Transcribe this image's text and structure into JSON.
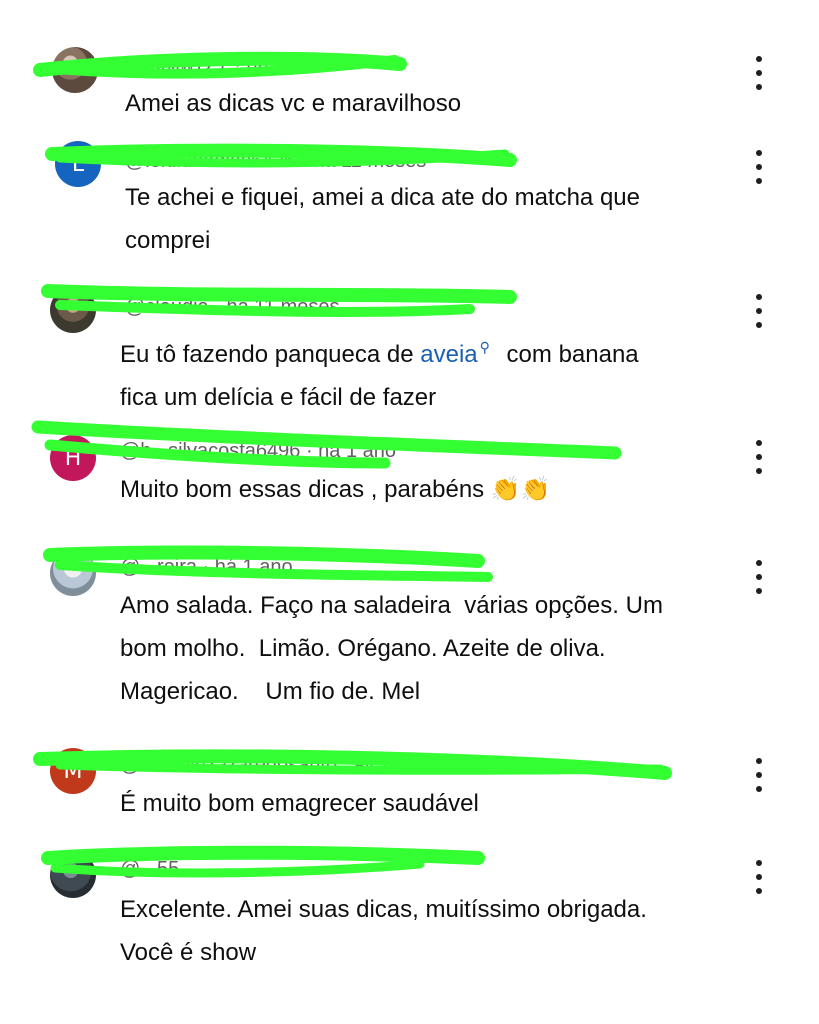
{
  "comments": [
    {
      "author": "@lucilw7Z7 · há 1 ano",
      "avatar_letter": "",
      "text": "Amei as dicas vc e maravilhoso"
    },
    {
      "author": "@leidiunedias5426 · há 11 meses",
      "avatar_letter": "L",
      "text": "Te achei e fiquei, amei a dica ate do matcha que\ncomprei"
    },
    {
      "author": "@claudia · há 11 meses",
      "avatar_letter": "",
      "text_before": "Eu tô fazendo panqueca de ",
      "link_text": "aveia",
      "link_icon": "search-icon",
      "text_after": " com banana\nfica um delícia e fácil de fazer"
    },
    {
      "author": "@h...silvacosta6496 · há 1 ano",
      "avatar_letter": "H",
      "text": "Muito bom essas dicas , parabéns ",
      "emoji": "👏👏"
    },
    {
      "author": "@...reira · há 1 ano",
      "avatar_letter": "",
      "text": "Amo salada. Faço na saladeira  várias opções. Um\nbom molho.  Limão. Orégano. Azeite de oliva.\nMagericao.    Um fio de. Mel"
    },
    {
      "author": "@marialuzazaredosanto...ail.785 · há 11 meses",
      "avatar_letter": "M",
      "text": "É muito bom emagrecer saudável"
    },
    {
      "author": "@...55",
      "avatar_letter": "",
      "text": "Excelente. Amei suas dicas, muitíssimo obrigada.\nVocê é show"
    }
  ],
  "colors": {
    "redaction": "#33ff33",
    "avatar_L": "#1565c0",
    "avatar_H": "#c2185b",
    "avatar_M": "#c0391b",
    "link": "#1a5fb4"
  },
  "menu_icon": "more-vert-icon"
}
